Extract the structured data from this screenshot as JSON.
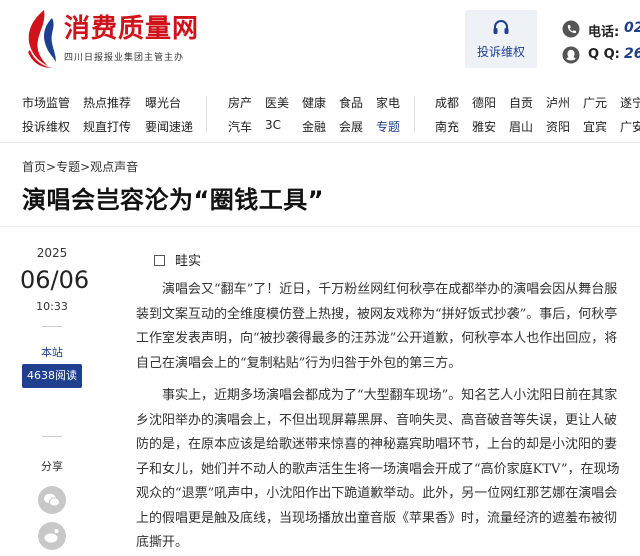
{
  "brand": {
    "title": "消费质量网",
    "subtitle": "四川日报报业集团主管主办"
  },
  "header": {
    "complaint_label": "投诉维权",
    "phone_label": "电话:",
    "phone_value": "02",
    "qq_label": "Q Q:",
    "qq_value": "26"
  },
  "nav": {
    "group1": [
      {
        "label": "市场监管"
      },
      {
        "label": "热点推荐"
      },
      {
        "label": "曝光台"
      },
      {
        "label": "投诉维权"
      },
      {
        "label": "规直打传"
      },
      {
        "label": "要闻速递"
      }
    ],
    "group2": [
      {
        "label": "房产"
      },
      {
        "label": "医美"
      },
      {
        "label": "健康"
      },
      {
        "label": "食品"
      },
      {
        "label": "家电"
      },
      {
        "label": "汽车"
      },
      {
        "label": "3C"
      },
      {
        "label": "金融"
      },
      {
        "label": "会展"
      },
      {
        "label": "专题"
      }
    ],
    "group3": [
      {
        "label": "成都"
      },
      {
        "label": "德阳"
      },
      {
        "label": "自贡"
      },
      {
        "label": "泸州"
      },
      {
        "label": "广元"
      },
      {
        "label": "遂宁"
      },
      {
        "label": "南充"
      },
      {
        "label": "雅安"
      },
      {
        "label": "眉山"
      },
      {
        "label": "资阳"
      },
      {
        "label": "宜宾"
      },
      {
        "label": "广安"
      }
    ],
    "active": "专题"
  },
  "breadcrumb": {
    "home": "首页",
    "sep": ">",
    "section": "专题",
    "current": "观点声音"
  },
  "article": {
    "title": "演唱会岂容沦为“圈钱工具”",
    "year": "2025",
    "date": "06/06",
    "time": "10:33",
    "source": "本站",
    "reads": "4638阅读",
    "share_label": "分享",
    "author": "畦实",
    "paragraphs": [
      "演唱会又“翻车”了！近日，千万粉丝网红何秋亭在成都举办的演唱会因从舞台服装到文案互动的全维度模仿登上热搜，被网友戏称为“拼好饭式抄袭”。事后，何秋亭工作室发表声明，向“被抄袭得最多的汪苏泷”公开道歉，何秋亭本人也作出回应，将自己在演唱会上的“复制粘贴”行为归咎于外包的第三方。",
      "事实上，近期多场演唱会都成为了“大型翻车现场”。知名艺人小沈阳日前在其家乡沈阳举办的演唱会上，不但出现屏幕黑屏、音响失灵、高音破音等失误，更让人破防的是，在原本应该是给歌迷带来惊喜的神秘嘉宾助唱环节，上台的却是小沈阳的妻子和女儿，她们并不动人的歌声活生生将一场演唱会开成了“高价家庭KTV”，在现场观众的“退票”吼声中，小沈阳作出下跪道歉举动。此外，另一位网红那艺娜在演唱会上的假唱更是触及底线，当现场播放出童音版《苹果香》时，流量经济的遮羞布被彻底撕开。"
    ]
  }
}
